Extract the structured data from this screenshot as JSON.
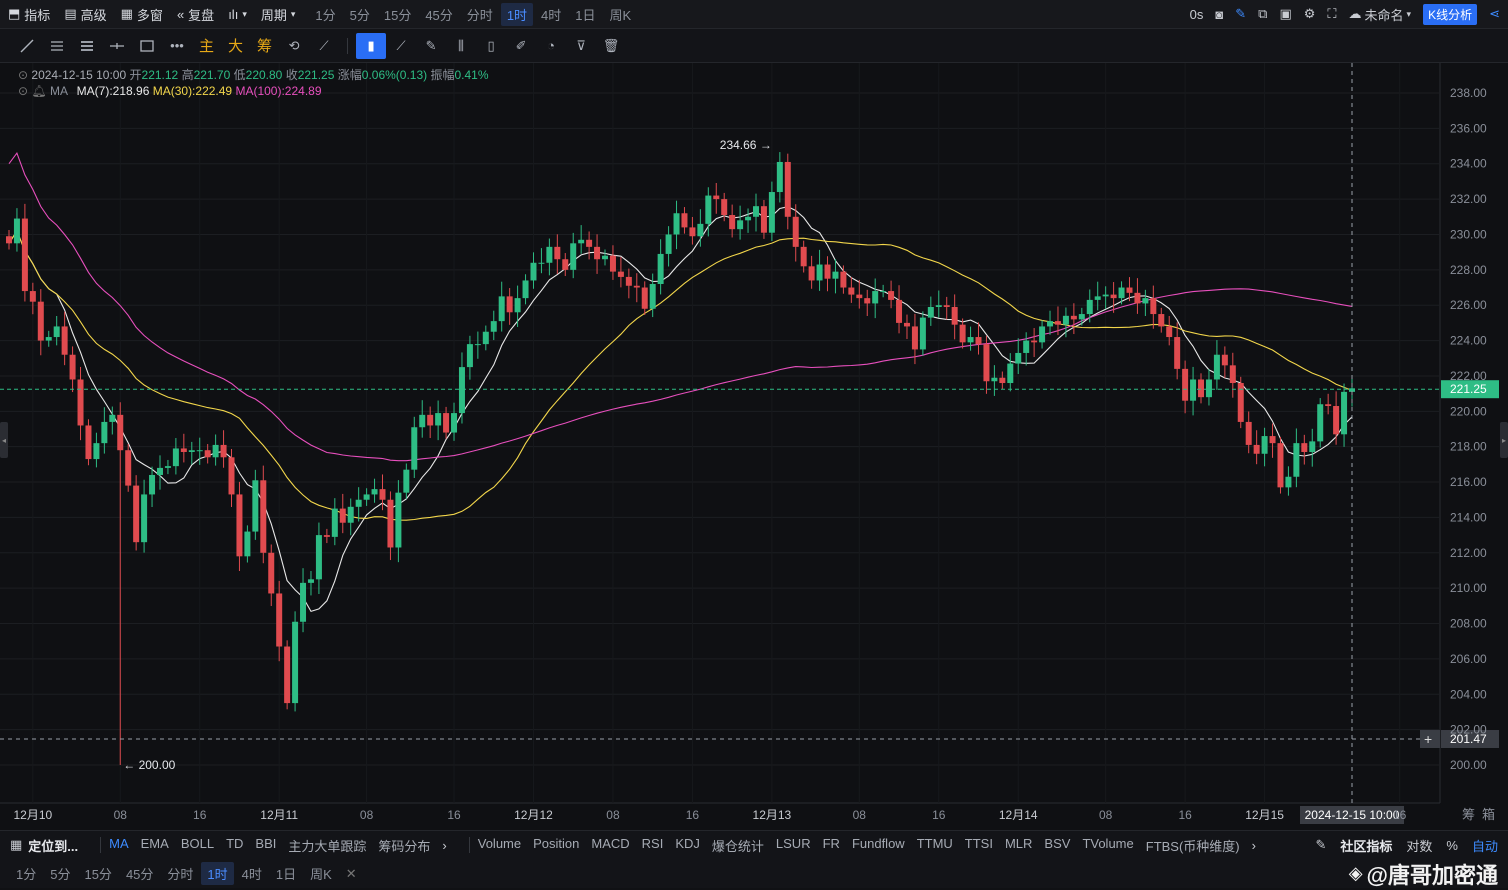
{
  "topbar": {
    "indicators_label": "指标",
    "advanced_label": "高级",
    "multiwindow_label": "多窗",
    "replay_label": "复盘",
    "period_label": "周期",
    "timeframes": [
      "1分",
      "5分",
      "15分",
      "45分",
      "分时",
      "1时",
      "4时",
      "1日",
      "周K"
    ],
    "active_timeframe": "1时",
    "latency": "0s",
    "layout_name": "未命名",
    "kline_button": "K线分析"
  },
  "toolbar": {
    "cn_tools": [
      "主",
      "大",
      "筹"
    ]
  },
  "legend": {
    "datetime": "2024-12-15 10:00",
    "open_label": "开",
    "open": "221.12",
    "high_label": "高",
    "high": "221.70",
    "low_label": "低",
    "low": "220.80",
    "close_label": "收",
    "close": "221.25",
    "change_label": "涨幅",
    "change": "0.06%(0.13)",
    "amp_label": "振幅",
    "amp": "0.41%",
    "ma_name": "MA",
    "ma7": "MA(7):218.96",
    "ma30": "MA(30):222.49",
    "ma100": "MA(100):224.89",
    "colors": {
      "ma7": "#e8e8e8",
      "ma30": "#f2d64b",
      "ma100": "#e74fbd",
      "up": "#2ebd85",
      "down": "#e04b4f"
    }
  },
  "chart_data": {
    "type": "candlestick",
    "ylim": [
      199,
      239
    ],
    "y_ticks": [
      "238.00",
      "236.00",
      "234.00",
      "232.00",
      "230.00",
      "228.00",
      "226.00",
      "224.00",
      "222.00",
      "220.00",
      "218.00",
      "216.00",
      "214.00",
      "212.00",
      "210.00",
      "208.00",
      "206.00",
      "204.00",
      "202.00",
      "200.00"
    ],
    "x_ticks": [
      "12月10",
      "08",
      "16",
      "12月11",
      "08",
      "16",
      "12月12",
      "08",
      "16",
      "12月13",
      "08",
      "16",
      "12月14",
      "08",
      "16",
      "12月15",
      "16"
    ],
    "last_price": "221.25",
    "crosshair_price": "201.47",
    "crosshair_time": "2024-12-15 10:00",
    "max_label": "234.66 →",
    "min_label": "← 200.00",
    "closes": [
      229.5,
      230.9,
      226.8,
      226.2,
      224.0,
      224.2,
      224.8,
      223.2,
      221.8,
      219.2,
      217.3,
      218.2,
      219.4,
      219.8,
      217.8,
      215.8,
      212.6,
      215.3,
      216.4,
      216.8,
      216.9,
      217.9,
      217.7,
      217.8,
      217.8,
      217.4,
      218.1,
      217.4,
      215.3,
      211.8,
      213.2,
      216.1,
      212.0,
      209.7,
      206.7,
      203.5,
      208.1,
      210.3,
      210.5,
      213.0,
      212.9,
      214.5,
      213.7,
      214.6,
      215.0,
      215.3,
      215.6,
      215.0,
      212.3,
      215.4,
      216.7,
      219.1,
      219.8,
      219.2,
      219.9,
      218.8,
      219.9,
      222.5,
      223.8,
      223.8,
      224.5,
      225.1,
      226.5,
      225.6,
      226.4,
      227.4,
      228.4,
      228.4,
      229.3,
      228.6,
      228.0,
      229.5,
      229.7,
      229.3,
      228.6,
      228.8,
      227.9,
      227.6,
      227.1,
      227.0,
      225.8,
      227.2,
      228.9,
      230.0,
      231.2,
      230.4,
      229.9,
      230.6,
      232.2,
      232.0,
      231.1,
      230.3,
      230.8,
      231.0,
      231.6,
      230.1,
      232.4,
      234.1,
      231.0,
      229.3,
      228.2,
      227.4,
      228.3,
      227.5,
      227.9,
      227.0,
      226.6,
      226.4,
      226.1,
      226.8,
      226.8,
      226.3,
      225.0,
      224.8,
      223.5,
      225.3,
      225.9,
      226.0,
      225.9,
      224.9,
      223.9,
      224.2,
      223.8,
      221.7,
      221.9,
      221.6,
      222.7,
      223.3,
      224.0,
      223.9,
      224.8,
      225.1,
      224.9,
      225.4,
      225.2,
      225.5,
      226.3,
      226.5,
      226.6,
      226.4,
      227.0,
      226.7,
      226.1,
      226.4,
      225.5,
      224.8,
      224.2,
      222.4,
      220.6,
      221.8,
      220.8,
      221.8,
      223.2,
      222.6,
      221.6,
      219.4,
      218.1,
      217.6,
      218.6,
      218.2,
      215.7,
      216.3,
      218.2,
      217.7,
      218.3,
      220.4,
      220.3,
      218.7,
      221.1,
      221.3
    ]
  },
  "bottom": {
    "locate_label": "定位到...",
    "main_indicators": [
      "MA",
      "EMA",
      "BOLL",
      "TD",
      "BBI",
      "主力大单跟踪",
      "筹码分布"
    ],
    "active_main": "MA",
    "sub_indicators": [
      "Volume",
      "Position",
      "MACD",
      "RSI",
      "KDJ",
      "爆仓统计",
      "LSUR",
      "FR",
      "Fundflow",
      "TTMU",
      "TTSI",
      "MLR",
      "BSV",
      "TVolume",
      "FTBS(币种维度)"
    ],
    "community_label": "社区指标",
    "log_label": "对数",
    "pct_label": "%",
    "auto_label": "自动",
    "chip_label": "筹",
    "box_label": "箱",
    "timeframes": [
      "1分",
      "5分",
      "15分",
      "45分",
      "分时",
      "1时",
      "4时",
      "1日",
      "周K"
    ],
    "active_timeframe": "1时",
    "watermark": "@唐哥加密通"
  }
}
